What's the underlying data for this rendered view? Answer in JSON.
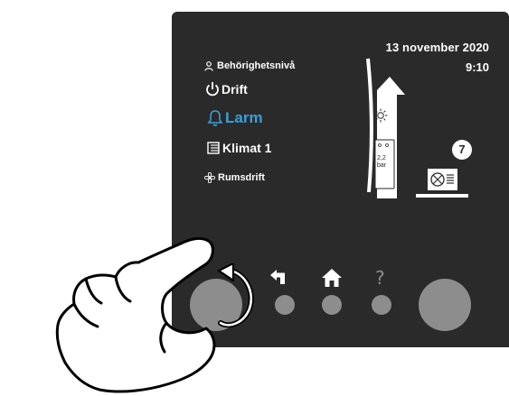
{
  "status": {
    "date": "13 november 2020",
    "time": "9:10"
  },
  "menu": {
    "access_level": "Behörighetsnivå",
    "drift": "Drift",
    "larm": "Larm",
    "klimat": "Klimat 1",
    "rumsdrift": "Rumsdrift"
  },
  "unit": {
    "badge": "7",
    "value_line1": "2,2",
    "value_line2": "bar"
  },
  "controls": {
    "help_label": "?"
  },
  "colors": {
    "panel": "#2a2a2a",
    "accent": "#3a9fd8",
    "button": "#8d8d8d"
  },
  "icons": [
    "person-icon",
    "power-icon",
    "bell-icon",
    "climate-icon",
    "fan-icon",
    "sun-icon",
    "outdoor-unit-icon",
    "back-icon",
    "home-icon",
    "help-icon",
    "rotate-icon",
    "hand-icon"
  ]
}
